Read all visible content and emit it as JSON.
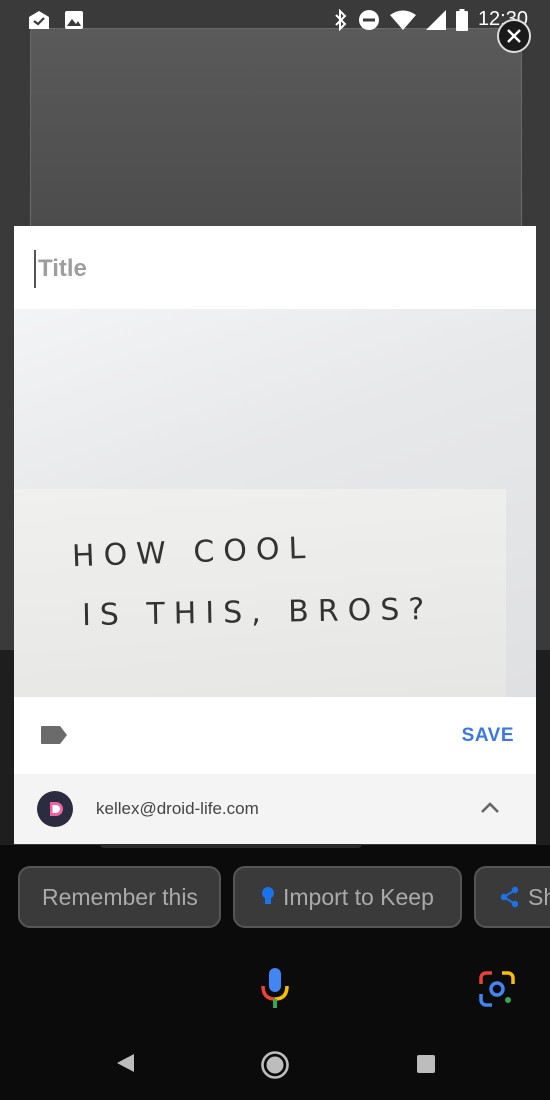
{
  "status_bar": {
    "time": "12:30",
    "left_icons": [
      "mail-check-icon",
      "image-icon"
    ],
    "right_icons": [
      "bluetooth-icon",
      "do-not-disturb-icon",
      "wifi-icon",
      "signal-icon",
      "battery-icon"
    ]
  },
  "note": {
    "title_placeholder": "Title",
    "title_value": "",
    "image_text_line1": "HOW COOL",
    "image_text_line2": "IS THIS, BROS?",
    "save_label": "SAVE"
  },
  "account": {
    "email": "kellex@droid-life.com"
  },
  "chips": [
    {
      "label": "Remember this"
    },
    {
      "label": "Import to Keep"
    },
    {
      "label": "Sh"
    }
  ],
  "colors": {
    "accent": "#3b78e7",
    "card_bg": "#ffffff",
    "account_bg": "#f4f4f4",
    "chip_bg": "#3a3a3a"
  }
}
